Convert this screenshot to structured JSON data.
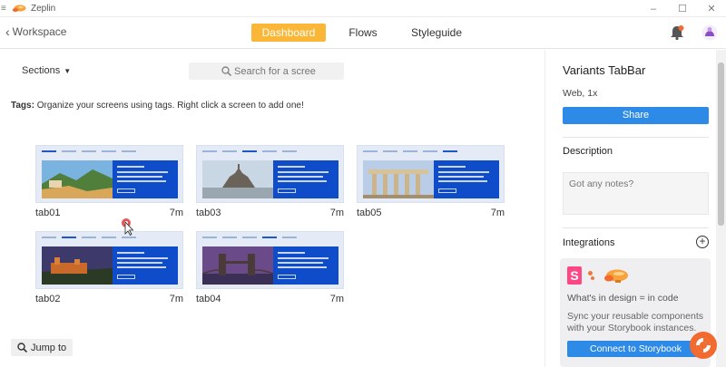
{
  "window": {
    "title": "Zeplin",
    "controls": [
      "–",
      "☐",
      "✕"
    ]
  },
  "nav": {
    "back_label": "Workspace",
    "tabs": [
      {
        "label": "Dashboard",
        "active": true
      },
      {
        "label": "Flows",
        "active": false
      },
      {
        "label": "Styleguide",
        "active": false
      }
    ]
  },
  "toolbar": {
    "sections_label": "Sections",
    "search_placeholder": "Search for a scree"
  },
  "tags": {
    "label": "Tags:",
    "hint": "Organize your screens using tags. Right click a screen to add one!"
  },
  "screens": [
    {
      "name": "tab01",
      "age": "7m"
    },
    {
      "name": "tab03",
      "age": "7m"
    },
    {
      "name": "tab05",
      "age": "7m"
    },
    {
      "name": "tab02",
      "age": "7m"
    },
    {
      "name": "tab04",
      "age": "7m"
    }
  ],
  "jump_label": "Jump to",
  "sidebar": {
    "screen_title": "Variants TabBar",
    "platform": "Web, 1x",
    "share_label": "Share",
    "description_heading": "Description",
    "notes_placeholder": "Got any notes?",
    "integrations_heading": "Integrations",
    "integration": {
      "logo_letter": "S",
      "headline": "What's in design = in code",
      "body": "Sync your reusable components with your Storybook instances.",
      "button": "Connect to Storybook"
    }
  },
  "colors": {
    "accent": "#f9b637",
    "primary": "#2d8ae6",
    "thumb_panel": "#0f4cc9",
    "storybook": "#ff4785",
    "help": "#f26a2e"
  }
}
